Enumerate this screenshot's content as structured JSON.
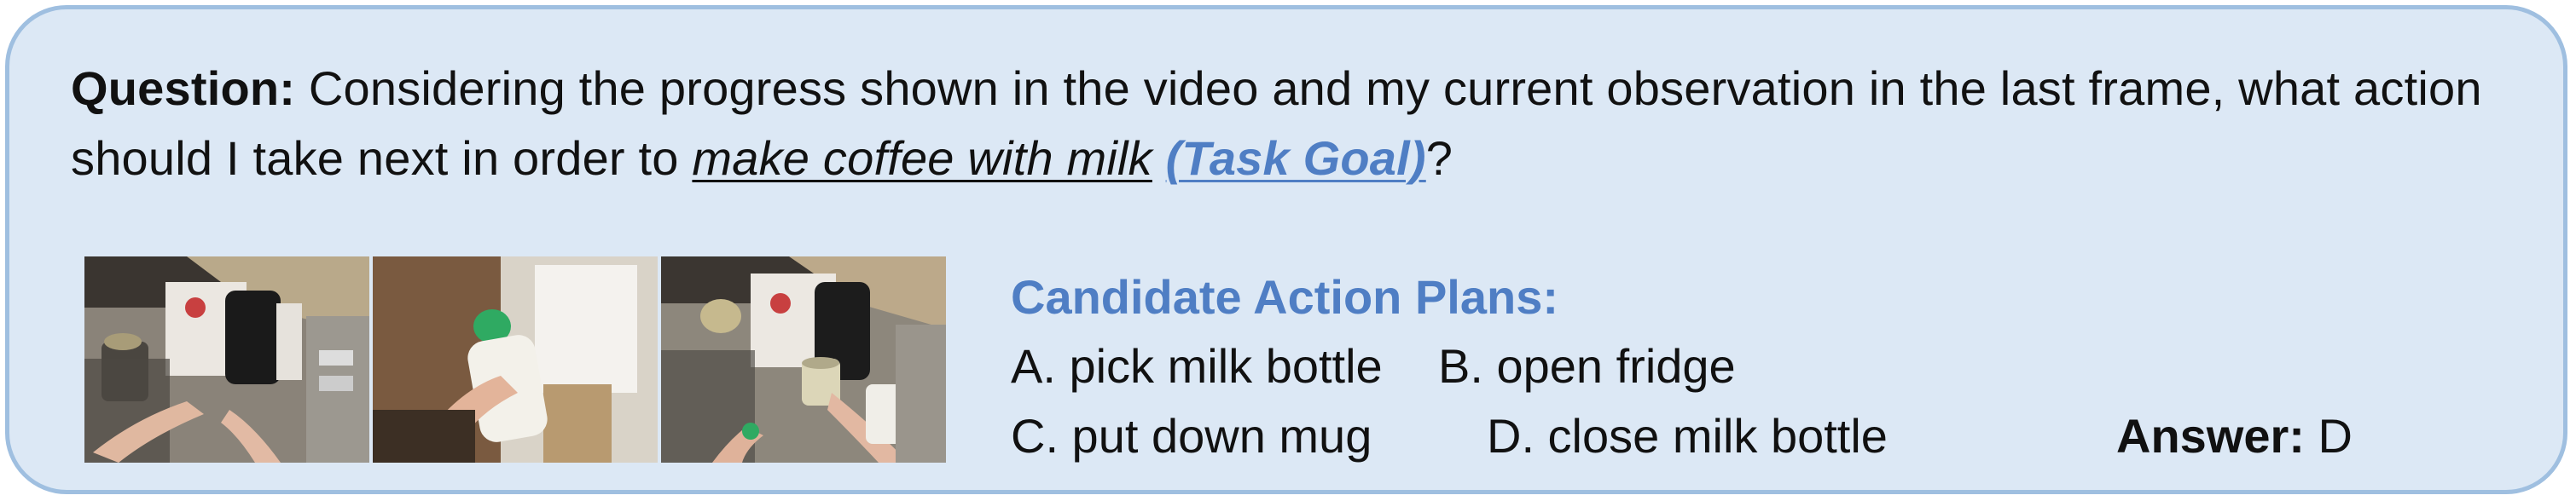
{
  "question": {
    "label": "Question:",
    "text_before": " Considering the progress shown in the video and my current observation in the last frame, what action should I take next in order to ",
    "task": "make coffee with milk",
    "task_goal": "(Task Goal)",
    "text_after": "?"
  },
  "frames": [
    {
      "name": "frame-1",
      "description_icon": "kitchen-counter-coffee-machine-image"
    },
    {
      "name": "frame-2",
      "description_icon": "fridge-milk-bottle-image"
    },
    {
      "name": "frame-3",
      "description_icon": "kitchen-counter-mug-image"
    }
  ],
  "plans": {
    "title": "Candidate Action Plans:",
    "options": {
      "a": "A. pick milk bottle",
      "b": "B. open fridge",
      "c": "C. put down mug",
      "d": "D. close milk bottle"
    }
  },
  "answer": {
    "label": "Answer:",
    "value": "D"
  },
  "colors": {
    "accent": "#4f7ec4",
    "card_background": "#dce8f5",
    "card_border": "#9fbfe0"
  }
}
